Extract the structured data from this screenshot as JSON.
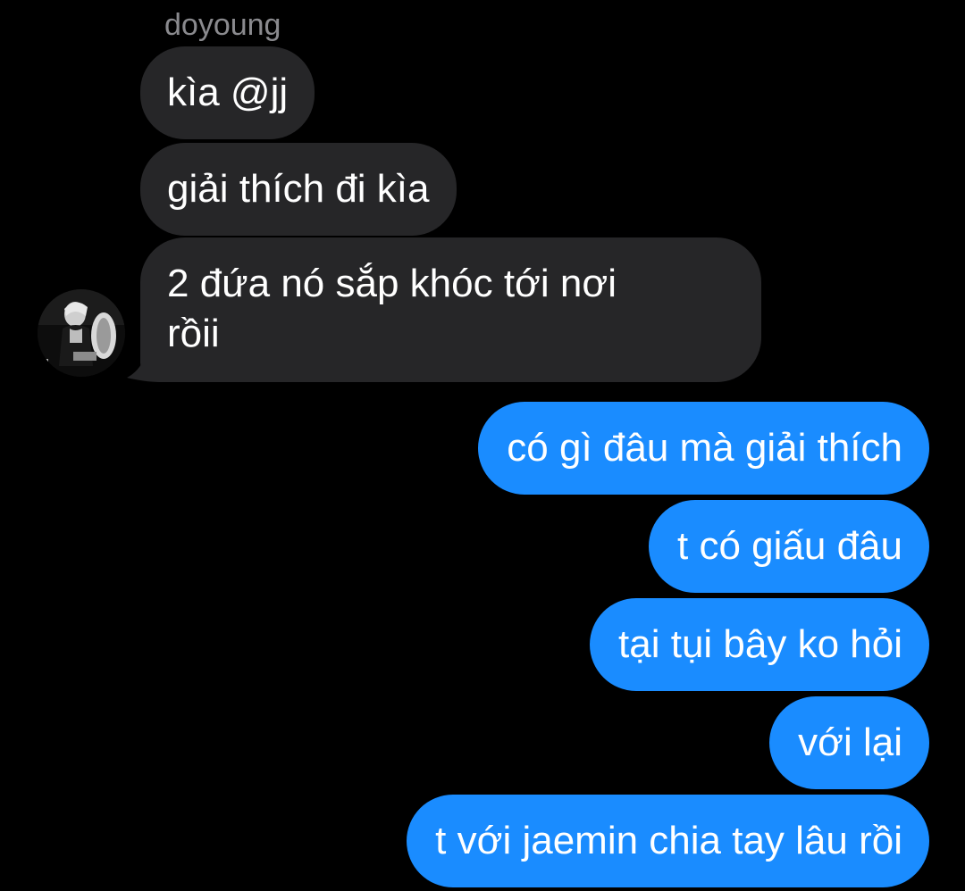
{
  "conversation": {
    "incoming_sender": "doyoung",
    "incoming": [
      {
        "text": "kìa @jj"
      },
      {
        "text": "giải thích đi kìa"
      },
      {
        "text_line1": "2 đứa nó sắp khóc tới nơi",
        "text_line2": "rồii"
      }
    ],
    "outgoing": [
      {
        "text": "có gì đâu mà giải thích"
      },
      {
        "text": "t có giấu đâu"
      },
      {
        "text": "tại tụi bây ko hỏi"
      },
      {
        "text": "với lại"
      },
      {
        "text": "t với jaemin chia tay lâu rồi"
      }
    ]
  },
  "colors": {
    "background": "#000000",
    "incoming_bubble": "#262628",
    "outgoing_bubble": "#1a8cff",
    "sender_name": "#8a8a8e",
    "text": "#ffffff"
  },
  "icons": {
    "avatar": "sender-avatar-photo"
  }
}
